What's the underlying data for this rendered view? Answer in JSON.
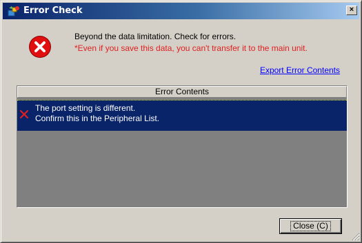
{
  "window": {
    "title": "Error Check",
    "close_glyph": "×"
  },
  "icons": {
    "app": "error-check-app-icon",
    "status": "error-icon",
    "row_status": "red-x-icon"
  },
  "message": {
    "line1": "Beyond the data limitation. Check for errors.",
    "line2": "*Even if you save this data, you can't transfer it to the main unit.",
    "line2_color": "#e02020"
  },
  "export_link": "Export Error Contents",
  "error_list": {
    "header": "Error Contents",
    "rows": [
      {
        "line1": "The port setting is different.",
        "line2": "Confirm this in the Peripheral List."
      }
    ]
  },
  "buttons": {
    "close_label": "Close (C)"
  },
  "colors": {
    "face": "#d4d0c8",
    "title_start": "#0a246a",
    "selection": "#0a246a",
    "list_bg": "#808080",
    "error_red": "#e01010",
    "link": "#0000ff"
  }
}
